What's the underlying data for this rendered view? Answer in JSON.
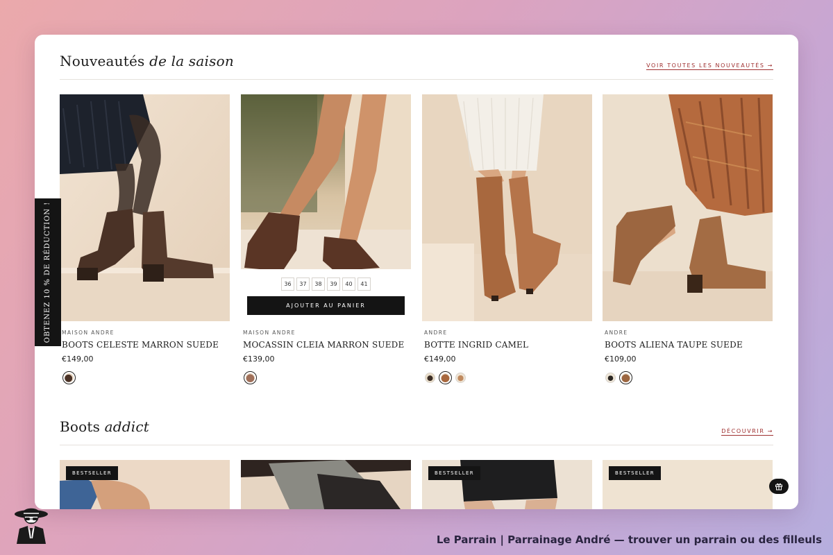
{
  "sections": {
    "new": {
      "title_plain": "Nouveautés",
      "title_italic": "de la saison",
      "link": "VOIR TOUTES LES NOUVEAUTÉS →"
    },
    "boots": {
      "title_plain": "Boots",
      "title_italic": "addict",
      "link": "DÉCOUVRIR →"
    }
  },
  "side_tab": {
    "label": "OBTENEZ 10 % DE RÉDUCTION !"
  },
  "products": [
    {
      "brand": "MAISON ANDRE",
      "name": "BOOTS CELESTE MARRON SUEDE",
      "price": "€149,00"
    },
    {
      "brand": "MAISON ANDRE",
      "name": "MOCASSIN CLEIA MARRON SUEDE",
      "price": "€139,00",
      "sizes": [
        "36",
        "37",
        "38",
        "39",
        "40",
        "41"
      ],
      "add_to_cart": "AJOUTER AU PANIER"
    },
    {
      "brand": "ANDRE",
      "name": "BOTTE INGRID CAMEL",
      "price": "€149,00"
    },
    {
      "brand": "ANDRE",
      "name": "BOOTS ALIENA TAUPE SUEDE",
      "price": "€109,00"
    }
  ],
  "badges": [
    "BESTSELLER",
    "BESTSELLER",
    "BESTSELLER"
  ],
  "footer": {
    "text": "Le Parrain | Parrainage André — trouver un parrain ou des filleuls"
  },
  "colors": {
    "accent": "#9e2e2e",
    "dark": "#141414"
  }
}
